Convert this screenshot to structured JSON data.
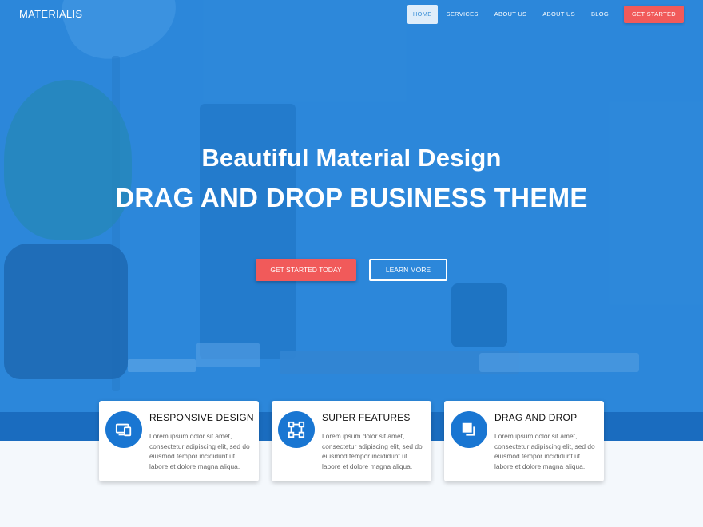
{
  "header": {
    "brand": "MATERIALIS",
    "nav": [
      "HOME",
      "SERVICES",
      "ABOUT US",
      "ABOUT US",
      "BLOG"
    ],
    "active_index": 0,
    "cta": "GET STARTED"
  },
  "hero": {
    "title": "Beautiful Material Design",
    "subtitle": "DRAG AND DROP BUSINESS THEME",
    "primary_button": "GET STARTED TODAY",
    "secondary_button": "LEARN MORE"
  },
  "features": [
    {
      "icon": "responsive-devices-icon",
      "title": "RESPONSIVE DESIGN",
      "text": "Lorem ipsum dolor sit amet, consectetur adipiscing elit, sed do eiusmod tempor incididunt ut labore et dolore magna aliqua."
    },
    {
      "icon": "vector-square-icon",
      "title": "SUPER FEATURES",
      "text": "Lorem ipsum dolor sit amet, consectetur adipiscing elit, sed do eiusmod tempor incididunt ut labore et dolore magna aliqua."
    },
    {
      "icon": "layers-icon",
      "title": "DRAG AND DROP",
      "text": "Lorem ipsum dolor sit amet, consectetur adipiscing elit, sed do eiusmod tempor incididunt ut labore et dolore magna aliqua."
    }
  ],
  "colors": {
    "hero_overlay": "#3f8fd8",
    "accent": "#f15a5a",
    "icon_circle": "#1976d2",
    "page_bg": "#f4f8fc"
  }
}
